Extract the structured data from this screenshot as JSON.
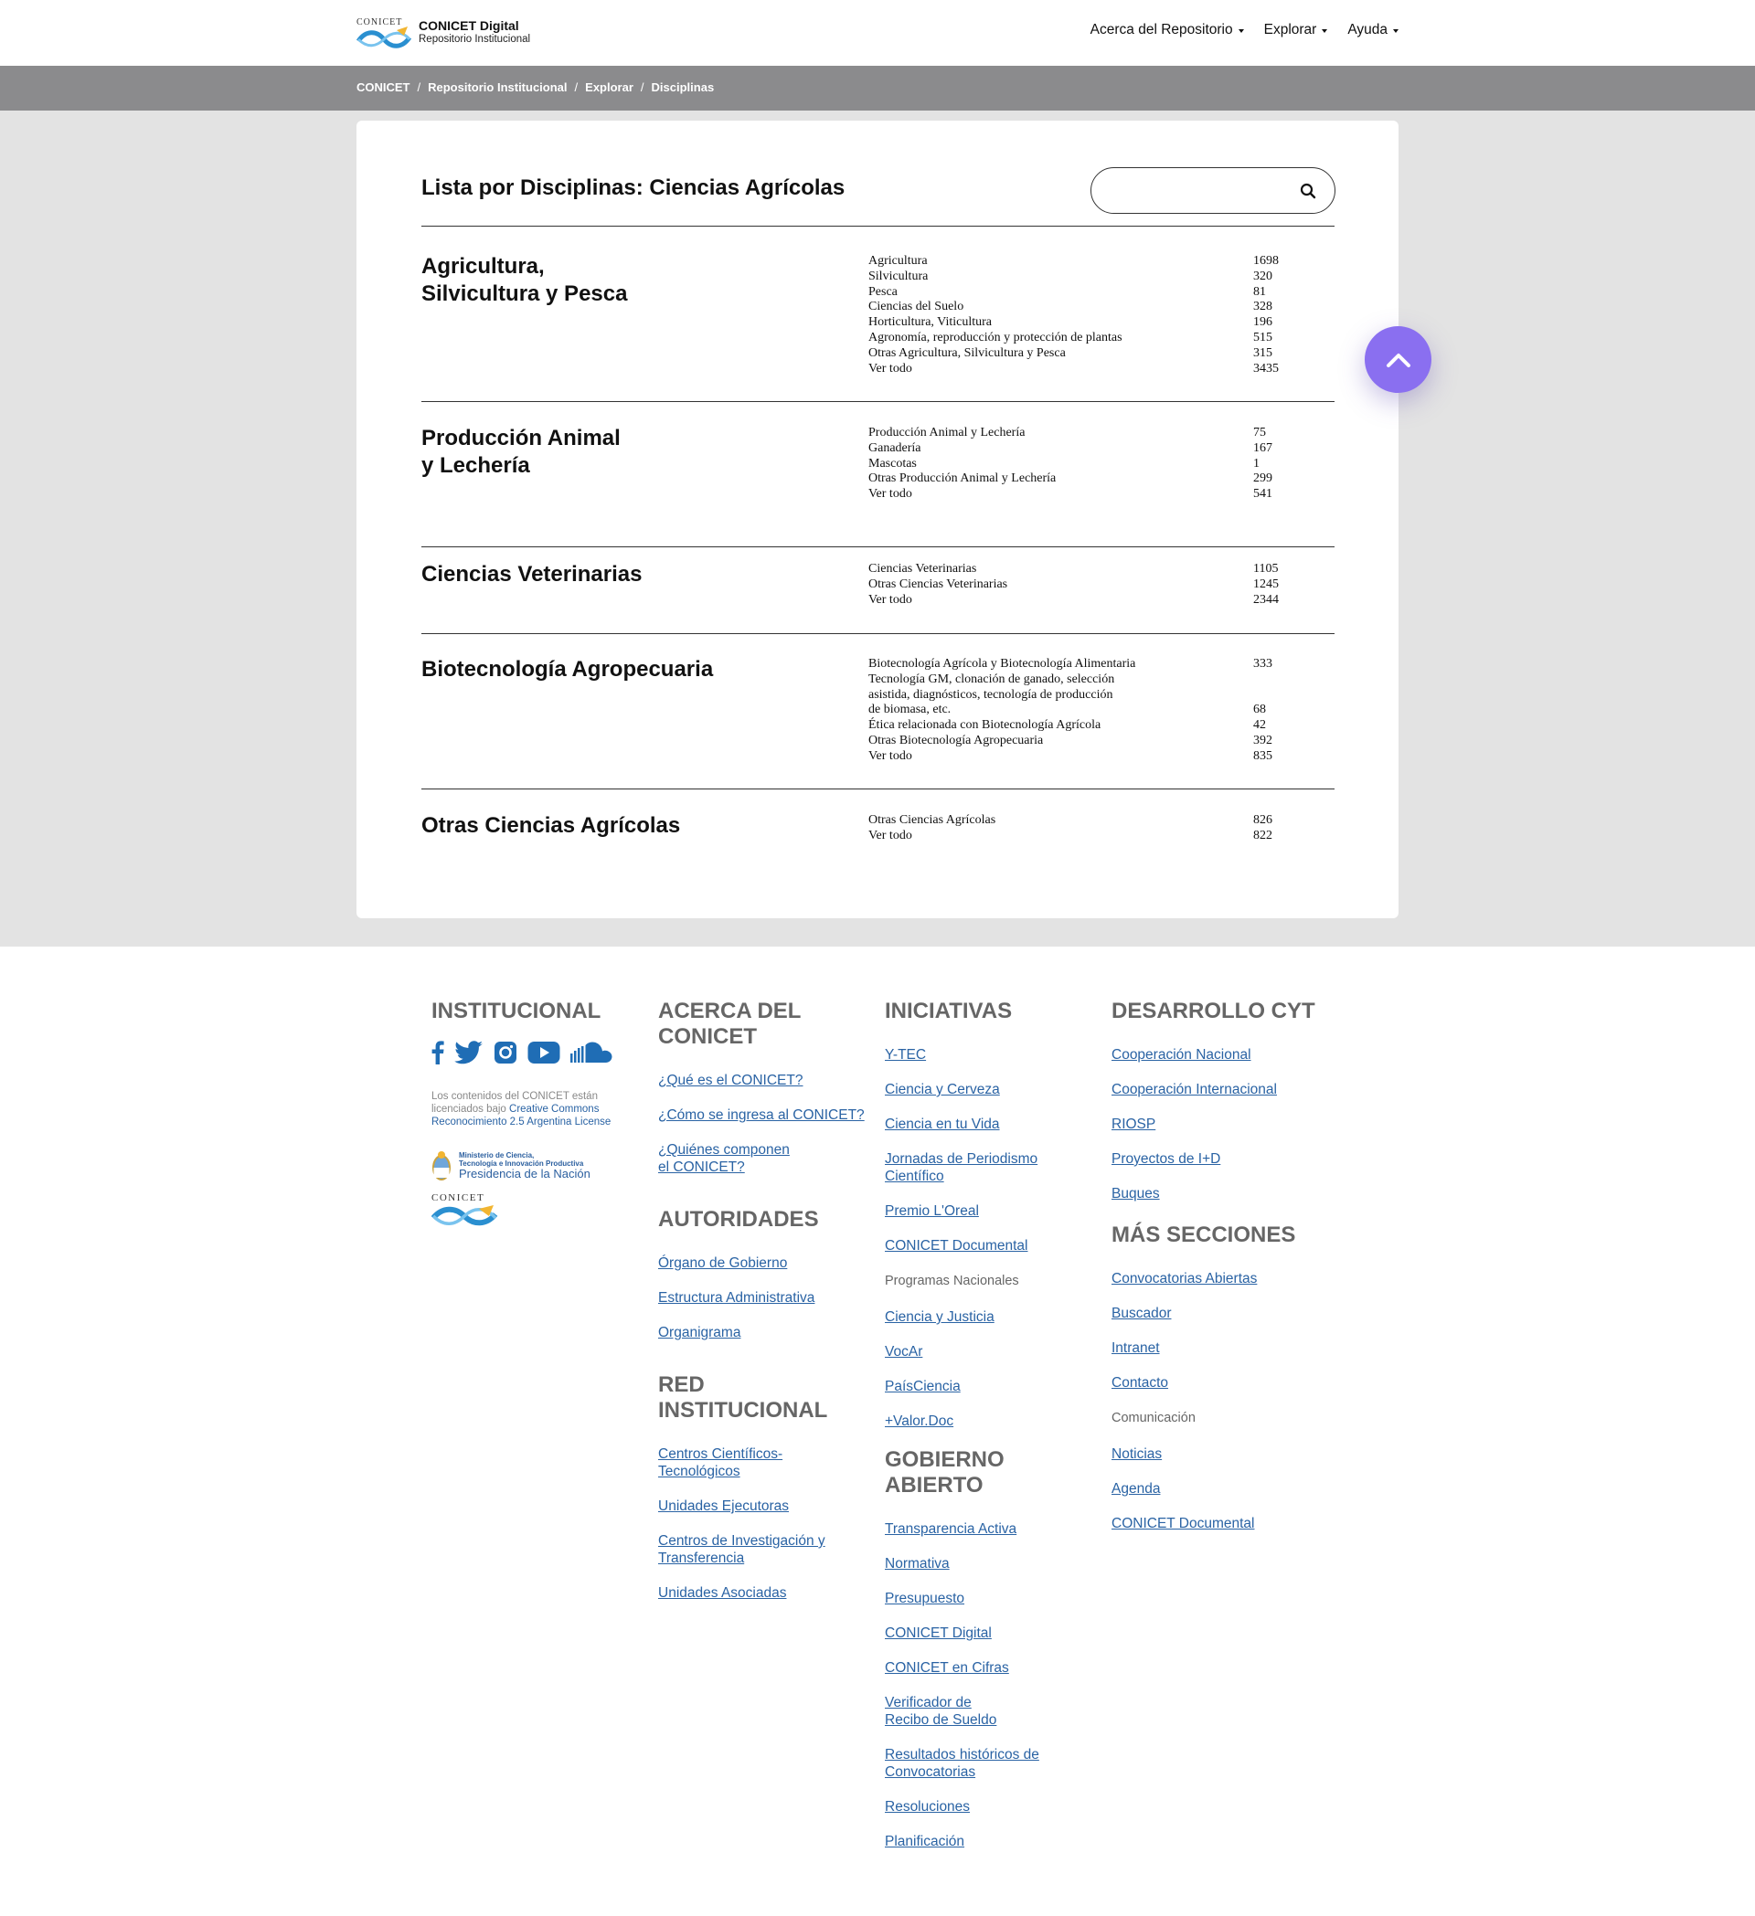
{
  "header": {
    "logo_word": "CONICET",
    "title": "CONICET Digital",
    "subtitle": "Repositorio Institucional",
    "nav": [
      {
        "label": "Acerca del Repositorio"
      },
      {
        "label": "Explorar"
      },
      {
        "label": "Ayuda"
      }
    ]
  },
  "breadcrumb": [
    "CONICET",
    "Repositorio Institucional",
    "Explorar",
    "Disciplinas"
  ],
  "breadcrumb_sep": "/",
  "main": {
    "title": "Lista por Disciplinas: Ciencias Agrícolas",
    "search_placeholder": "",
    "sections": [
      {
        "title_lines": [
          "Agricultura,",
          "Silvicultura y Pesca"
        ],
        "items": [
          {
            "label": "Agricultura",
            "count": "1698"
          },
          {
            "label": "Silvicultura",
            "count": "320"
          },
          {
            "label": "Pesca",
            "count": "81"
          },
          {
            "label": "Ciencias del Suelo",
            "count": "328"
          },
          {
            "label": "Horticultura, Viticultura",
            "count": "196"
          },
          {
            "label": "Agronomía, reproducción y protección de plantas",
            "count": "515"
          },
          {
            "label": "Otras Agricultura, Silvicultura y Pesca",
            "count": "315"
          },
          {
            "label": "Ver todo",
            "count": "3435"
          }
        ]
      },
      {
        "title_lines": [
          "Producción Animal",
          "y Lechería"
        ],
        "items": [
          {
            "label": "Producción Animal y Lechería",
            "count": "75"
          },
          {
            "label": "Ganadería",
            "count": "167"
          },
          {
            "label": "Mascotas",
            "count": "1"
          },
          {
            "label": "Otras Producción Animal y Lechería",
            "count": "299"
          },
          {
            "label": "Ver todo",
            "count": "541"
          }
        ]
      },
      {
        "title_lines": [
          "Ciencias Veterinarias"
        ],
        "items": [
          {
            "label": "Ciencias Veterinarias",
            "count": "1105"
          },
          {
            "label": "Otras Ciencias Veterinarias",
            "count": "1245"
          },
          {
            "label": "Ver todo",
            "count": "2344"
          }
        ]
      },
      {
        "title_lines": [
          "Biotecnología Agropecuaria"
        ],
        "items": [
          {
            "label": "Biotecnología Agrícola y Biotecnología Alimentaria",
            "count": "333"
          },
          {
            "label": "Tecnología GM, clonación de ganado, selección",
            "count": ""
          },
          {
            "label": "asistida, diagnósticos, tecnología de producción",
            "count": ""
          },
          {
            "label": "de biomasa, etc.",
            "count": "68"
          },
          {
            "label": "Ética relacionada con Biotecnología Agrícola",
            "count": "42"
          },
          {
            "label": "Otras Biotecnología Agropecuaria",
            "count": "392"
          },
          {
            "label": "Ver todo",
            "count": "835"
          }
        ]
      },
      {
        "title_lines": [
          "Otras Ciencias Agrícolas"
        ],
        "items": [
          {
            "label": "Otras Ciencias Agrícolas",
            "count": "826"
          },
          {
            "label": "Ver todo",
            "count": "822"
          }
        ]
      }
    ]
  },
  "footer": {
    "institucional": {
      "heading": "INSTITUCIONAL",
      "social_icons": [
        "facebook-icon",
        "twitter-icon",
        "instagram-icon",
        "youtube-icon",
        "soundcloud-icon"
      ],
      "license_prefix": "Los contenidos del CONICET están licenciados bajo ",
      "license_link": "Creative Commons Reconocimiento 2.5 Argentina License",
      "ministry_top": "Ministerio de Ciencia,",
      "ministry_mid": "Tecnología e Innovación Productiva",
      "ministry_bottom": "Presidencia de la Nación",
      "logo_word": "CONICET"
    },
    "acerca": {
      "heading": "ACERCA DEL CONICET",
      "links": [
        "¿Qué es el CONICET?",
        "¿Cómo se ingresa al CONICET?",
        "¿Quiénes componen el CONICET?"
      ]
    },
    "autoridades": {
      "heading": "AUTORIDADES",
      "links": [
        "Órgano de Gobierno",
        "Estructura Administrativa",
        "Organigrama"
      ]
    },
    "red": {
      "heading": "RED INSTITUCIONAL",
      "links": [
        "Centros Científicos-Tecnológicos",
        "Unidades Ejecutoras",
        "Centros de Investigación y Transferencia",
        "Unidades Asociadas"
      ]
    },
    "iniciativas": {
      "heading": "INICIATIVAS",
      "links": [
        "Y-TEC",
        "Ciencia y Cerveza",
        "Ciencia en tu Vida",
        "Jornadas de Periodismo Científico",
        "Premio L'Oreal",
        "CONICET Documental"
      ],
      "sub": "Programas Nacionales",
      "sub_links": [
        "Ciencia y Justicia",
        "VocAr",
        "PaísCiencia",
        "+Valor.Doc"
      ]
    },
    "gobierno": {
      "heading": "GOBIERNO ABIERTO",
      "links": [
        "Transparencia Activa",
        "Normativa",
        "Presupuesto",
        "CONICET Digital",
        "CONICET en Cifras",
        "Verificador de Recibo de Sueldo",
        "Resultados históricos de Convocatorias",
        "Resoluciones",
        "Planificación"
      ]
    },
    "desarrollo": {
      "heading": "DESARROLLO CYT",
      "links": [
        "Cooperación Nacional",
        "Cooperación Internacional",
        "RIOSP",
        "Proyectos de I+D",
        "Buques"
      ]
    },
    "mas": {
      "heading": "MÁS SECCIONES",
      "links": [
        "Convocatorias Abiertas",
        "Buscador",
        "Intranet",
        "Contacto"
      ],
      "sub": "Comunicación",
      "sub_links": [
        "Noticias",
        "Agenda",
        "CONICET Documental"
      ]
    }
  },
  "colors": {
    "accent": "#8a6ff0",
    "link": "#2a63a4",
    "breadcrumb_bg": "#8b8b8d",
    "content_bg": "#e3e3e3"
  }
}
